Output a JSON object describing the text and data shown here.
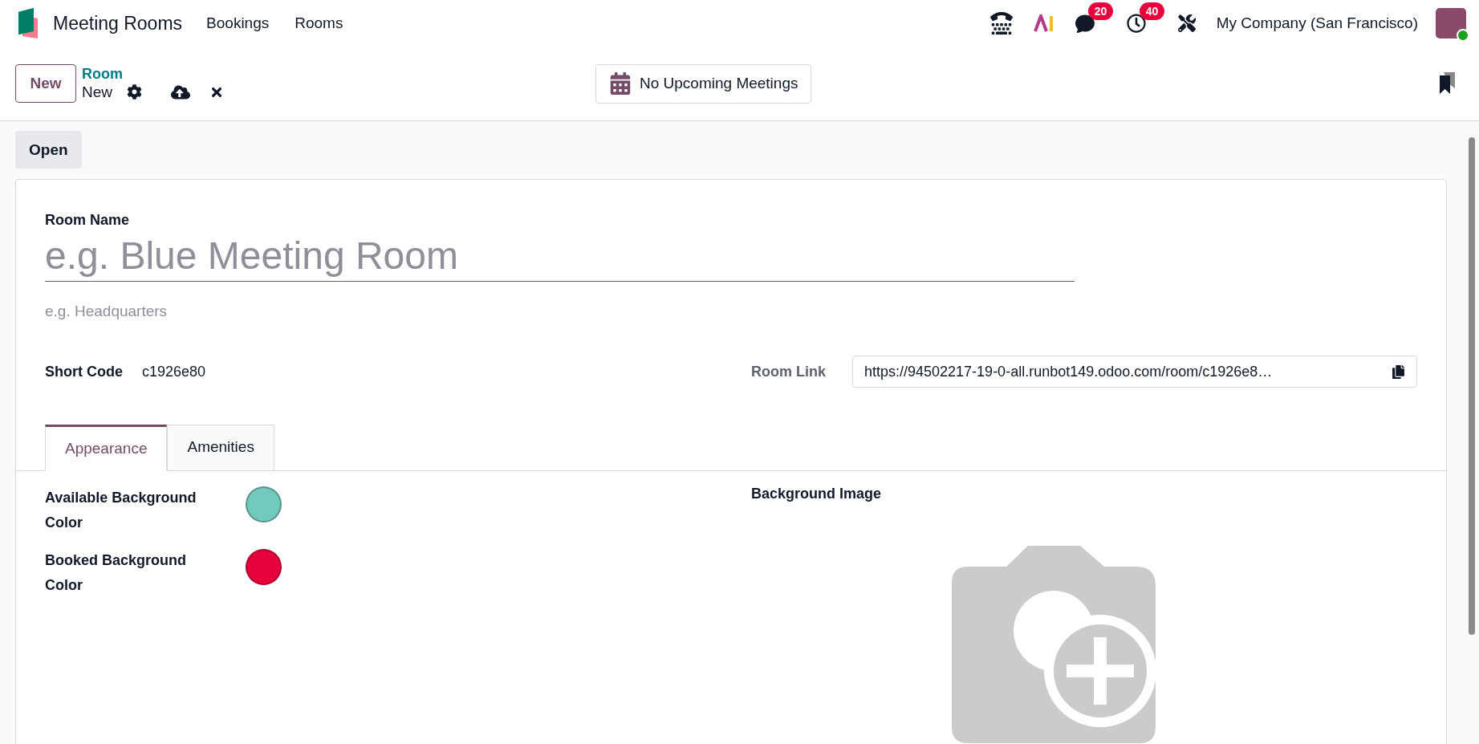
{
  "navbar": {
    "app_name": "Meeting Rooms",
    "menu": [
      {
        "label": "Bookings"
      },
      {
        "label": "Rooms"
      }
    ],
    "badges": [
      {
        "kind": "chat",
        "count": "20"
      },
      {
        "kind": "activity",
        "count": "40"
      }
    ],
    "company": "My Company (San Francisco)",
    "user_online": true
  },
  "control_panel": {
    "new_button": "New",
    "breadcrumb": {
      "parent": "Room",
      "current": "New"
    },
    "status_button": "No Upcoming Meetings"
  },
  "actions": {
    "open_button": "Open"
  },
  "form": {
    "room_name": {
      "label": "Room Name",
      "placeholder": "e.g. Blue Meeting Room"
    },
    "location": {
      "placeholder": "e.g. Headquarters"
    },
    "short_code": {
      "label": "Short Code",
      "value": "c1926e80"
    },
    "room_link": {
      "label": "Room Link",
      "value": "https://94502217-19-0-all.runbot149.odoo.com/room/c1926e8…"
    },
    "tabs": [
      {
        "label": "Appearance",
        "selected": true
      },
      {
        "label": "Amenities",
        "selected": false
      }
    ],
    "colors": [
      {
        "label": "Available Background Color",
        "color": "#73c9bc"
      },
      {
        "label": "Booked Background Color",
        "color": "#e8003d"
      }
    ],
    "background_image": {
      "label": "Background Image"
    }
  }
}
